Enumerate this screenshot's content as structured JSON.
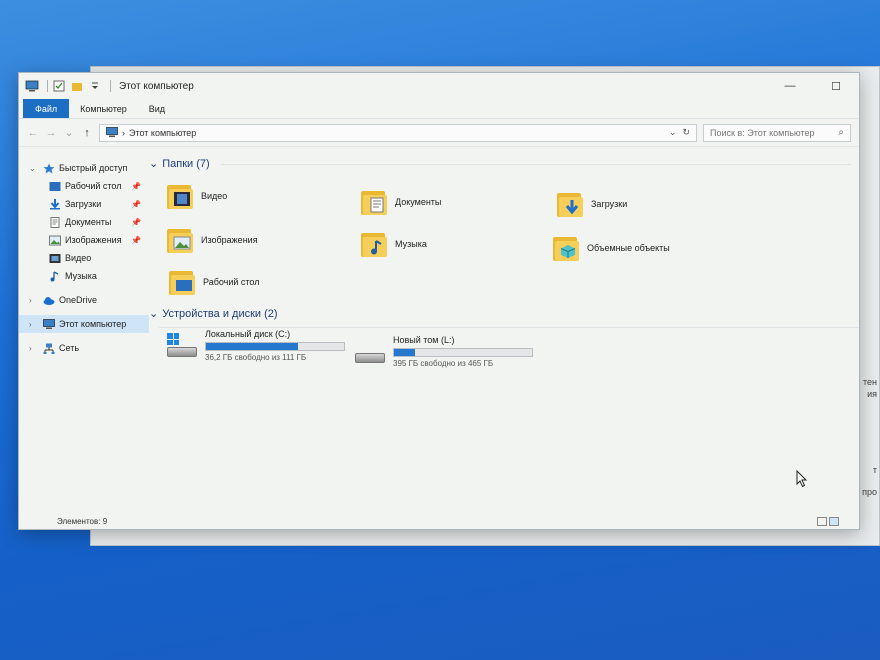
{
  "window": {
    "title": "Этот компьютер"
  },
  "ribbon": {
    "tabs": [
      "Файл",
      "Компьютер",
      "Вид"
    ]
  },
  "address": {
    "path": "Этот компьютер"
  },
  "search": {
    "placeholder": "Поиск в: Этот компьютер"
  },
  "sidebar": {
    "quick_access": "Быстрый доступ",
    "quick_items": [
      {
        "label": "Рабочий стол",
        "icon": "desktop-icon",
        "pinned": true
      },
      {
        "label": "Загрузки",
        "icon": "downloads-icon",
        "pinned": true
      },
      {
        "label": "Документы",
        "icon": "documents-icon",
        "pinned": true
      },
      {
        "label": "Изображения",
        "icon": "pictures-icon",
        "pinned": true
      },
      {
        "label": "Видео",
        "icon": "videos-icon",
        "pinned": false
      },
      {
        "label": "Музыка",
        "icon": "music-icon",
        "pinned": false
      }
    ],
    "onedrive": "OneDrive",
    "this_pc": "Этот компьютер",
    "network": "Сеть"
  },
  "folders": {
    "header": "Папки (7)",
    "items": [
      {
        "label": "Видео",
        "icon": "video-folder-icon"
      },
      {
        "label": "Документы",
        "icon": "documents-folder-icon"
      },
      {
        "label": "Загрузки",
        "icon": "downloads-folder-icon"
      },
      {
        "label": "Изображения",
        "icon": "pictures-folder-icon"
      },
      {
        "label": "Музыка",
        "icon": "music-folder-icon"
      },
      {
        "label": "Объемные объекты",
        "icon": "3d-objects-folder-icon"
      },
      {
        "label": "Рабочий стол",
        "icon": "desktop-folder-icon"
      }
    ]
  },
  "drives": {
    "header": "Устройства и диски (2)",
    "items": [
      {
        "label": "Локальный диск (C:)",
        "free": "36,2 ГБ свободно из 111 ГБ",
        "used_fraction": 0.67,
        "icon": "system-drive-icon"
      },
      {
        "label": "Новый том (L:)",
        "free": "395 ГБ свободно из 465 ГБ",
        "used_fraction": 0.15,
        "icon": "drive-icon"
      }
    ]
  },
  "status": {
    "items": "Элементов: 9"
  },
  "background_window": {
    "snippets": [
      "тен",
      "ия",
      "т",
      "юч про"
    ]
  },
  "colors": {
    "accent": "#1b6ec4",
    "folder": "#f5cf5a",
    "selection": "#cfe4f7",
    "bar": "#2678cf"
  }
}
